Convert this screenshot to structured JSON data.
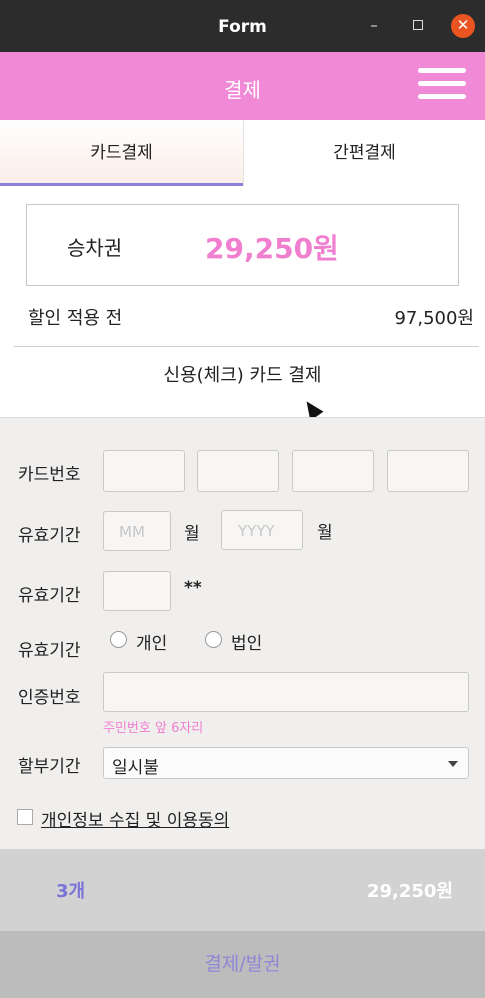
{
  "window": {
    "title": "Form",
    "minimize": "–",
    "close": "✕"
  },
  "header": {
    "title": "결제"
  },
  "tabs": [
    {
      "label": "카드결제",
      "active": true
    },
    {
      "label": "간편결제",
      "active": false
    }
  ],
  "ticket": {
    "label": "승차권",
    "price": "29,250원"
  },
  "discount": {
    "label": "할인 적용 전",
    "value": "97,500원"
  },
  "credit_title": "신용(체크) 카드 결제",
  "form": {
    "card_number_label": "카드번호",
    "expiry_label": "유효기간",
    "expiry_month_placeholder": "MM",
    "expiry_month_unit": "월",
    "expiry_year_placeholder": "YYYY",
    "expiry_year_unit": "월",
    "password_label": "유효기간",
    "password_suffix": "**",
    "type_label": "유효기간",
    "type_options": [
      "개인",
      "법인"
    ],
    "auth_label": "인증번호",
    "auth_hint": "주민번호 앞 6자리",
    "installment_label": "할부기간",
    "installment_value": "일시불",
    "consent_label": "개인정보 수집 및 이용동의"
  },
  "summary": {
    "quantity": "3개",
    "total": "29,250원"
  },
  "pay_button": "결제/발권",
  "colors": {
    "accent": "#f08ad6",
    "price": "#f07fd0",
    "tab_underline": "#8a80d8",
    "summary_qty": "#7a74d8",
    "close_button": "#e95420"
  },
  "icons": {
    "menu": "hamburger-icon",
    "dropdown": "chevron-down-icon"
  }
}
